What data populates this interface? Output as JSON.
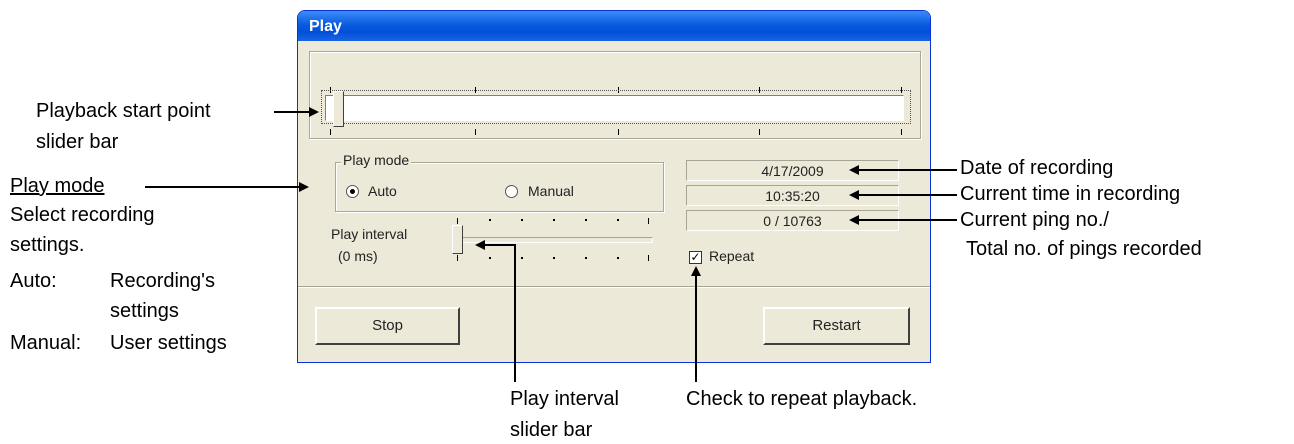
{
  "dialog": {
    "title": "Play",
    "play_mode": {
      "group_label": "Play mode",
      "options": [
        {
          "label": "Auto",
          "selected": true
        },
        {
          "label": "Manual",
          "selected": false
        }
      ]
    },
    "play_interval": {
      "label_line1": "Play interval",
      "label_line2": "(0 ms)"
    },
    "info": {
      "date": "4/17/2009",
      "time": "10:35:20",
      "ping": "0 / 10763"
    },
    "repeat": {
      "label": "Repeat",
      "checked": true
    },
    "buttons": {
      "stop": "Stop",
      "restart": "Restart"
    }
  },
  "annotations": {
    "start_slider": {
      "line1": "Playback start point",
      "line2": "slider bar"
    },
    "play_mode": {
      "heading": "Play mode",
      "line1": "Select recording",
      "line2": "settings.",
      "auto_key": "Auto:",
      "auto_val1": "Recording's",
      "auto_val2": "settings",
      "manual_key": "Manual:",
      "manual_val": "User settings"
    },
    "date": "Date of recording",
    "time": "Current time in recording",
    "ping": {
      "line1": "Current ping no./",
      "line2": "Total no. of pings recorded"
    },
    "interval_slider": {
      "line1": "Play interval",
      "line2": "slider bar"
    },
    "repeat": "Check to repeat playback."
  }
}
